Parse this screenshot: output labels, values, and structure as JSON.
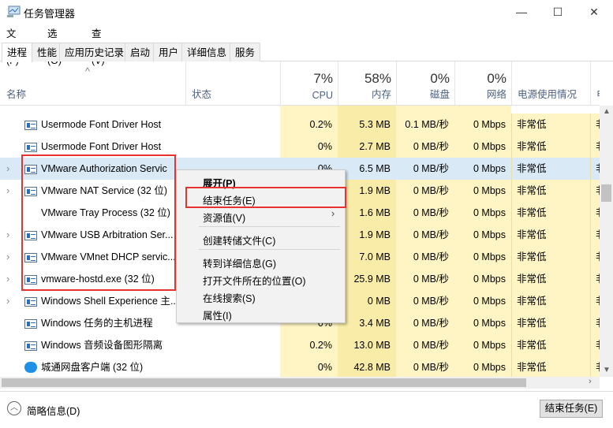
{
  "window": {
    "title": "任务管理器",
    "minimize": "—",
    "maximize": "☐",
    "close": "✕"
  },
  "menubar": [
    "文件(F)",
    "选项(O)",
    "查看(V)"
  ],
  "tabs": [
    "进程",
    "性能",
    "应用历史记录",
    "启动",
    "用户",
    "详细信息",
    "服务"
  ],
  "active_tab": "进程",
  "columns": {
    "name": "名称",
    "status": "状态",
    "cpu": {
      "pct": "7%",
      "label": "CPU"
    },
    "mem": {
      "pct": "58%",
      "label": "内存"
    },
    "disk": {
      "pct": "0%",
      "label": "磁盘"
    },
    "net": {
      "pct": "0%",
      "label": "网络"
    },
    "power": "电源使用情况",
    "power_trend": "电源"
  },
  "rows": [
    {
      "name": "Usermode Font Driver Host",
      "icon": "app",
      "expand": false,
      "cpu": "0.2%",
      "mem": "5.3 MB",
      "disk": "0.1 MB/秒",
      "net": "0 Mbps",
      "power": "非常低",
      "trend": "非"
    },
    {
      "name": "Usermode Font Driver Host",
      "icon": "app",
      "expand": false,
      "cpu": "0%",
      "mem": "2.7 MB",
      "disk": "0 MB/秒",
      "net": "0 Mbps",
      "power": "非常低",
      "trend": "非"
    },
    {
      "name": "VMware Authorization Servic",
      "icon": "app",
      "expand": true,
      "cpu": "0%",
      "mem": "6.5 MB",
      "disk": "0 MB/秒",
      "net": "0 Mbps",
      "power": "非常低",
      "trend": "非",
      "selected": true
    },
    {
      "name": "VMware NAT Service (32 位)",
      "icon": "app",
      "expand": true,
      "cpu": "",
      "mem": "1.9 MB",
      "disk": "0 MB/秒",
      "net": "0 Mbps",
      "power": "非常低",
      "trend": "非"
    },
    {
      "name": "VMware Tray Process (32 位)",
      "icon": "none",
      "expand": false,
      "cpu": "",
      "mem": "1.6 MB",
      "disk": "0 MB/秒",
      "net": "0 Mbps",
      "power": "非常低",
      "trend": "非"
    },
    {
      "name": "VMware USB Arbitration Ser...",
      "icon": "app",
      "expand": true,
      "cpu": "",
      "mem": "1.9 MB",
      "disk": "0 MB/秒",
      "net": "0 Mbps",
      "power": "非常低",
      "trend": "非"
    },
    {
      "name": "VMware VMnet DHCP servic...",
      "icon": "app",
      "expand": true,
      "cpu": "",
      "mem": "7.0 MB",
      "disk": "0 MB/秒",
      "net": "0 Mbps",
      "power": "非常低",
      "trend": "非"
    },
    {
      "name": "vmware-hostd.exe (32 位)",
      "icon": "app",
      "expand": true,
      "cpu": "",
      "mem": "25.9 MB",
      "disk": "0 MB/秒",
      "net": "0 Mbps",
      "power": "非常低",
      "trend": "非"
    },
    {
      "name": "Windows Shell Experience 主...",
      "icon": "app",
      "expand": true,
      "cpu": "",
      "mem": "0 MB",
      "disk": "0 MB/秒",
      "net": "0 Mbps",
      "power": "非常低",
      "trend": "非"
    },
    {
      "name": "Windows 任务的主机进程",
      "icon": "app",
      "expand": false,
      "cpu": "0%",
      "mem": "3.4 MB",
      "disk": "0 MB/秒",
      "net": "0 Mbps",
      "power": "非常低",
      "trend": "非"
    },
    {
      "name": "Windows 音频设备图形隔离",
      "icon": "app",
      "expand": false,
      "cpu": "0.2%",
      "mem": "13.0 MB",
      "disk": "0 MB/秒",
      "net": "0 Mbps",
      "power": "非常低",
      "trend": "非"
    },
    {
      "name": "城通网盘客户端 (32 位)",
      "icon": "cloud",
      "expand": false,
      "cpu": "0%",
      "mem": "42.8 MB",
      "disk": "0 MB/秒",
      "net": "0 Mbps",
      "power": "非常低",
      "trend": "非"
    }
  ],
  "context_menu": {
    "items": [
      "展开(P)",
      "结束任务(E)",
      "资源值(V)",
      "创建转储文件(C)",
      "转到详细信息(G)",
      "打开文件所在的位置(O)",
      "在线搜索(S)",
      "属性(I)"
    ],
    "highlighted": "结束任务(E)",
    "submenu_arrow": "›"
  },
  "footer": {
    "fewer_details": "简略信息(D)",
    "end_task": "结束任务(E)"
  },
  "colors": {
    "highlight_box": "#e8322f",
    "usage_bg": "#fff4c4",
    "selected_row": "#d9e9f5"
  }
}
